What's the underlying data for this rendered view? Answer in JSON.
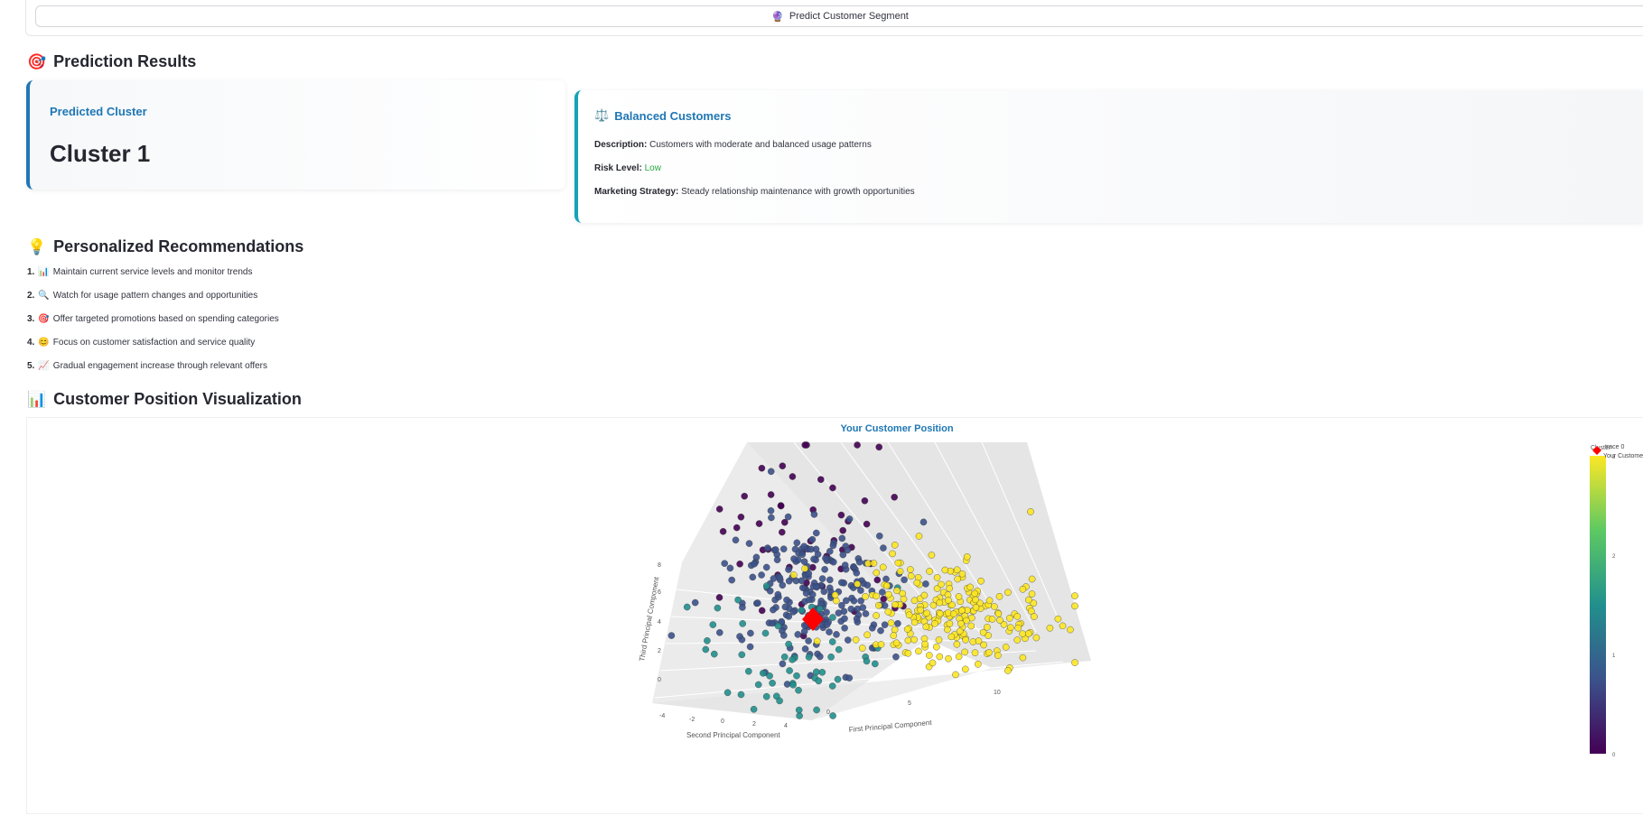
{
  "predict_button": {
    "icon": "🔮",
    "label": "Predict Customer Segment"
  },
  "results": {
    "heading_icon": "🎯",
    "heading": "Prediction Results",
    "cluster_label": "Predicted Cluster",
    "cluster_value": "Cluster 1",
    "profile": {
      "icon": "⚖️",
      "title": "Balanced Customers",
      "description_label": "Description:",
      "description": "Customers with moderate and balanced usage patterns",
      "risk_label": "Risk Level:",
      "risk": "Low",
      "risk_color": "#28a745",
      "strategy_label": "Marketing Strategy:",
      "strategy": "Steady relationship maintenance with growth opportunities"
    }
  },
  "recommendations": {
    "heading_icon": "💡",
    "heading": "Personalized Recommendations",
    "items": [
      {
        "num": "1.",
        "icon": "📊",
        "text": "Maintain current service levels and monitor trends"
      },
      {
        "num": "2.",
        "icon": "🔍",
        "text": "Watch for usage pattern changes and opportunities"
      },
      {
        "num": "3.",
        "icon": "🎯",
        "text": "Offer targeted promotions based on spending categories"
      },
      {
        "num": "4.",
        "icon": "😊",
        "text": "Focus on customer satisfaction and service quality"
      },
      {
        "num": "5.",
        "icon": "📈",
        "text": "Gradual engagement increase through relevant offers"
      }
    ]
  },
  "visualization": {
    "heading_icon": "📊",
    "heading": "Customer Position Visualization"
  },
  "chart_data": {
    "type": "scatter",
    "title": "Your Customer Position",
    "xlabel": "First Principal Component",
    "ylabel": "Second Principal Component",
    "zlabel": "Third Principal Component",
    "z_ticks": [
      "0",
      "2",
      "4",
      "6",
      "8"
    ],
    "y_ticks": [
      "-4",
      "-2",
      "0",
      "2",
      "4"
    ],
    "x_ticks": [
      "0",
      "5",
      "10"
    ],
    "colorbar": {
      "title": "Cluster",
      "ticks": [
        "0",
        "1",
        "2",
        "3"
      ],
      "range": [
        0,
        3
      ]
    },
    "legend": [
      "trace 0",
      "Your Customer"
    ],
    "legend_placement": "top-right",
    "palette": [
      "#440154",
      "#3b528b",
      "#21908d",
      "#5dc963",
      "#fde725"
    ],
    "highlight_color": "#ff0000",
    "series": [
      {
        "name": "trace 0",
        "cluster_counts": {
          "0": 55,
          "1": 230,
          "2": 55,
          "3": 230
        }
      },
      {
        "name": "Your Customer",
        "cluster": 1
      }
    ]
  }
}
